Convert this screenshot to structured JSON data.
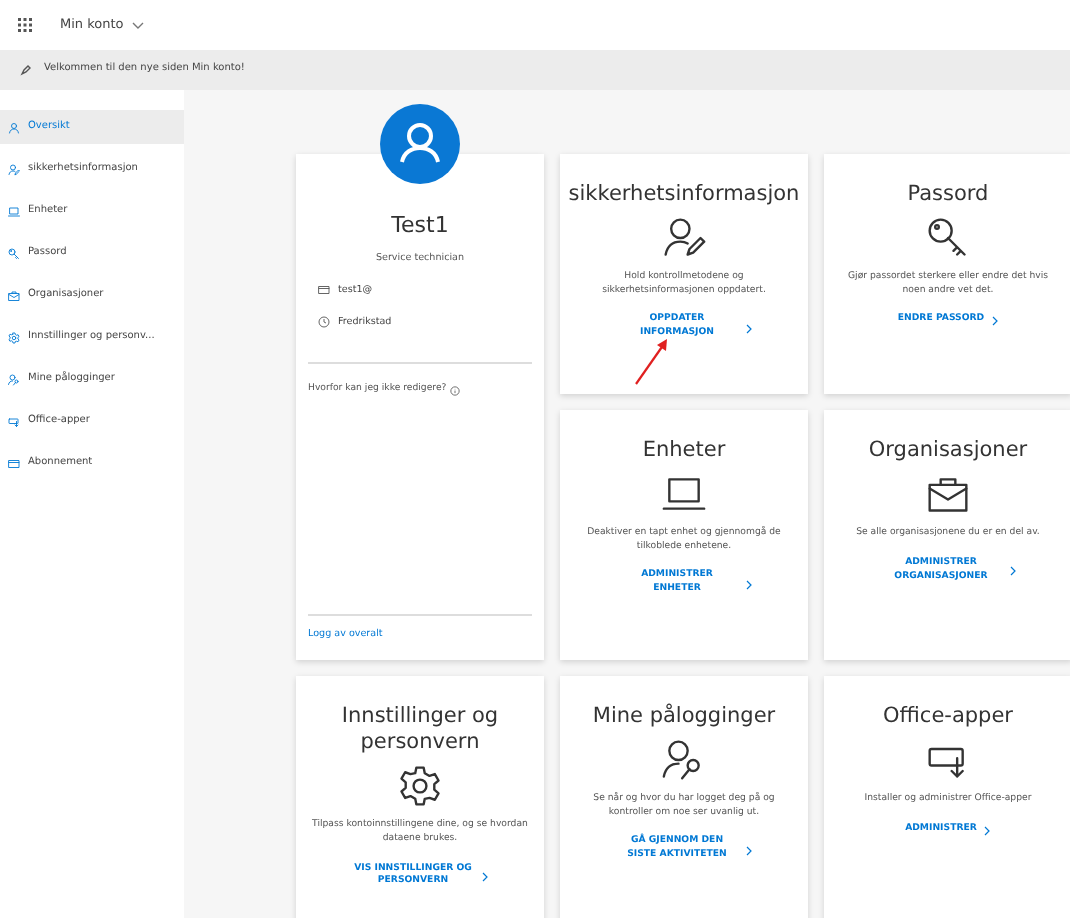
{
  "header": {
    "title": "Min konto"
  },
  "banner": {
    "text": "Velkommen til den nye siden Min konto!"
  },
  "sidebar": {
    "items": [
      {
        "label": "Oversikt",
        "selected": true,
        "kind": "person"
      },
      {
        "label": "sikkerhetsinformasjon",
        "selected": false,
        "kind": "person-edit"
      },
      {
        "label": "Enheter",
        "selected": false,
        "kind": "laptop"
      },
      {
        "label": "Passord",
        "selected": false,
        "kind": "key"
      },
      {
        "label": "Organisasjoner",
        "selected": false,
        "kind": "briefcase"
      },
      {
        "label": "Innstillinger og personv...",
        "selected": false,
        "kind": "gear"
      },
      {
        "label": "Mine pålogginger",
        "selected": false,
        "kind": "person-key"
      },
      {
        "label": "Office-apper",
        "selected": false,
        "kind": "download"
      },
      {
        "label": "Abonnement",
        "selected": false,
        "kind": "card"
      }
    ]
  },
  "profile": {
    "name": "Test1",
    "role": "Service technician",
    "email": "test1@",
    "location": "Fredrikstad",
    "question": "Hvorfor kan jeg ikke redigere?",
    "signout": "Logg av overalt"
  },
  "cards": [
    {
      "kind": "person-edit",
      "title": "sikkerhetsinformasjon",
      "description": "Hold kontrollmetodene og sikkerhetsinformasjonen oppdatert.",
      "link": "OPPDATER INFORMASJON"
    },
    {
      "kind": "key",
      "title": "Passord",
      "description": "Gjør passordet sterkere eller endre det hvis noen andre vet det.",
      "link": "ENDRE PASSORD"
    },
    {
      "kind": "laptop",
      "title": "Enheter",
      "description": "Deaktiver en tapt enhet og gjennomgå de tilkoblede enhetene.",
      "link": "ADMINISTRER ENHETER"
    },
    {
      "kind": "briefcase",
      "title": "Organisasjoner",
      "description": "Se alle organisasjonene du er en del av.",
      "link": "ADMINISTRER ORGANISASJONER"
    },
    {
      "kind": "gear",
      "title": "Innstillinger og personvern",
      "description": "Tilpass kontoinnstillingene dine, og se hvordan dataene brukes.",
      "link": "VIS INNSTILLINGER OG PERSONVERN"
    },
    {
      "kind": "person-key",
      "title": "Mine pålogginger",
      "description": "Se når og hvor du har logget deg på og kontroller om noe ser uvanlig ut.",
      "link": "GÅ GJENNOM DEN SISTE AKTIVITETEN"
    },
    {
      "kind": "download",
      "title": "Office-apper",
      "description": "Installer og administrer Office-apper",
      "link": "ADMINISTRER"
    }
  ]
}
